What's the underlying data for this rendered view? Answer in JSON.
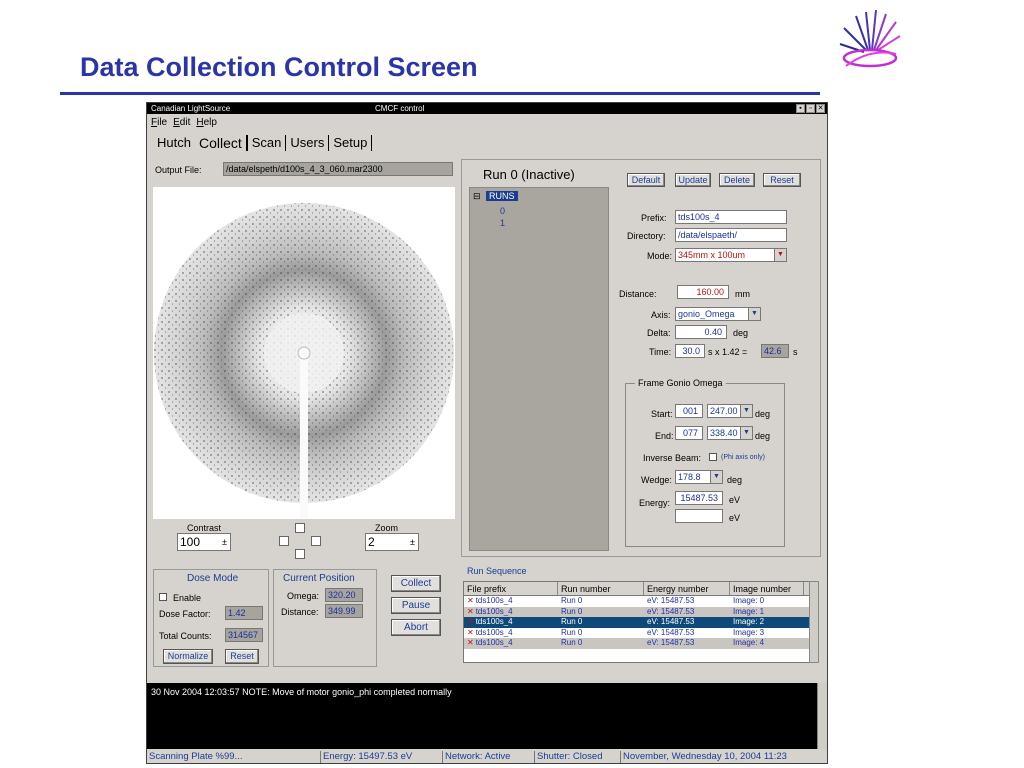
{
  "slide": {
    "title": "Data Collection Control Screen"
  },
  "window": {
    "app_name": "Canadian LightSource",
    "title": "CMCF control",
    "controls": [
      "▪",
      "▫",
      "✕"
    ]
  },
  "menu": {
    "items": [
      "File",
      "Edit",
      "Help"
    ]
  },
  "tabs": [
    "Hutch",
    "Collect",
    "Scan",
    "Users",
    "Setup"
  ],
  "output": {
    "label": "Output File:",
    "value": "/data/elspeth/d100s_4_3_060.mar2300"
  },
  "viewer": {
    "contrast_label": "Contrast",
    "contrast_value": "100",
    "zoom_label": "Zoom",
    "zoom_value": "2"
  },
  "dose": {
    "title": "Dose Mode",
    "enable_label": "Enable",
    "factor_label": "Dose Factor:",
    "factor_value": "1.42",
    "total_label": "Total Counts:",
    "total_value": "314567",
    "normalize_label": "Normalize",
    "reset_label": "Reset"
  },
  "position": {
    "title": "Current Position",
    "omega_label": "Omega:",
    "omega_value": "320.20",
    "distance_label": "Distance:",
    "distance_value": "349.99"
  },
  "actions": {
    "collect": "Collect",
    "pause": "Pause",
    "abort": "Abort"
  },
  "run": {
    "title": "Run 0 (Inactive)",
    "tree_root": "RUNS",
    "tree_nodes": [
      "0",
      "1"
    ]
  },
  "form": {
    "buttons": {
      "default": "Default",
      "update": "Update",
      "delete": "Delete",
      "reset": "Reset"
    },
    "prefix_label": "Prefix:",
    "prefix_value": "tds100s_4",
    "directory_label": "Directory:",
    "directory_value": "/data/elspaeth/",
    "mode_label": "Mode:",
    "mode_value": "345mm x 100um",
    "distance_label": "Distance:",
    "distance_value": "160.00",
    "distance_unit": "mm",
    "axis_label": "Axis:",
    "axis_value": "gonio_Omega",
    "delta_label": "Delta:",
    "delta_value": "0.40",
    "delta_unit": "deg",
    "time_label": "Time:",
    "time_value": "30.0",
    "time_mult": "s x 1.42 =",
    "time_result": "42.6",
    "time_unit": "s",
    "frame_title": "Frame Gonio Omega",
    "start_label": "Start:",
    "start_frame": "001",
    "start_angle": "247.00",
    "start_unit": "deg",
    "end_label": "End:",
    "end_frame": "077",
    "end_angle": "338.40",
    "end_unit": "deg",
    "inverse_label": "Inverse Beam:",
    "inverse_note": "(Phi axis only)",
    "wedge_label": "Wedge:",
    "wedge_value": "178.8",
    "wedge_unit": "deg",
    "energy_label": "Energy:",
    "energy_value": "15487.53",
    "energy_unit": "eV",
    "energy2_unit": "eV"
  },
  "sequence": {
    "title": "Run Sequence",
    "headers": [
      "File prefix",
      "Run number",
      "Energy number",
      "Image number"
    ],
    "rows": [
      [
        "tds100s_4",
        "Run 0",
        "eV: 15487.53",
        "Image: 0"
      ],
      [
        "tds100s_4",
        "Run 0",
        "eV: 15487.53",
        "Image: 1"
      ],
      [
        "tds100s_4",
        "Run 0",
        "eV: 15487.53",
        "Image: 2"
      ],
      [
        "tds100s_4",
        "Run 0",
        "eV: 15487.53",
        "Image: 3"
      ],
      [
        "tds100s_4",
        "Run 0",
        "eV: 15487.53",
        "Image: 4"
      ]
    ]
  },
  "log": {
    "message": "30 Nov 2004 12:03:57    NOTE: Move of motor gonio_phi completed normally"
  },
  "status": {
    "scanning": "Scanning Plate %99...",
    "energy": "Energy: 15497.53 eV",
    "network": "Network: Active",
    "shutter": "Shutter: Closed",
    "datetime": "November, Wednesday 10, 2004  11:23"
  }
}
